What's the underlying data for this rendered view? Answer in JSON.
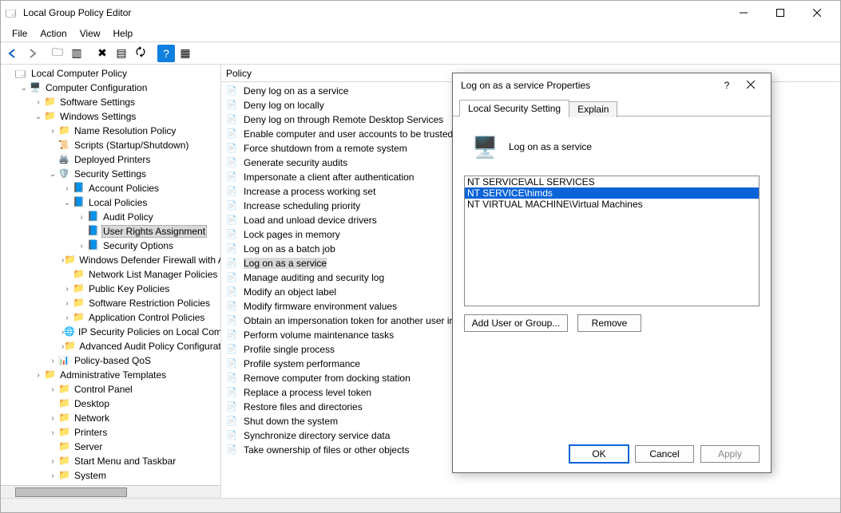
{
  "window": {
    "title": "Local Group Policy Editor"
  },
  "menu": [
    "File",
    "Action",
    "View",
    "Help"
  ],
  "tree_header": "Local Computer Policy",
  "tree": [
    {
      "ind": 0,
      "tw": "",
      "ic": "console-icon",
      "label": "Local Computer Policy"
    },
    {
      "ind": 1,
      "tw": "v",
      "ic": "pc-icon",
      "label": "Computer Configuration"
    },
    {
      "ind": 2,
      "tw": ">",
      "ic": "folder-icon",
      "label": "Software Settings"
    },
    {
      "ind": 2,
      "tw": "v",
      "ic": "folder-icon",
      "label": "Windows Settings"
    },
    {
      "ind": 3,
      "tw": ">",
      "ic": "folder-icon",
      "label": "Name Resolution Policy"
    },
    {
      "ind": 3,
      "tw": "",
      "ic": "script-icon",
      "label": "Scripts (Startup/Shutdown)"
    },
    {
      "ind": 3,
      "tw": "",
      "ic": "printer-icon",
      "label": "Deployed Printers"
    },
    {
      "ind": 3,
      "tw": "v",
      "ic": "shield-icon",
      "label": "Security Settings"
    },
    {
      "ind": 4,
      "tw": ">",
      "ic": "book-icon",
      "label": "Account Policies"
    },
    {
      "ind": 4,
      "tw": "v",
      "ic": "book-icon",
      "label": "Local Policies"
    },
    {
      "ind": 5,
      "tw": ">",
      "ic": "book-icon",
      "label": "Audit Policy"
    },
    {
      "ind": 5,
      "tw": "",
      "ic": "book-icon",
      "label": "User Rights Assignment",
      "sel": true
    },
    {
      "ind": 5,
      "tw": ">",
      "ic": "book-icon",
      "label": "Security Options"
    },
    {
      "ind": 4,
      "tw": ">",
      "ic": "folder-icon",
      "label": "Windows Defender Firewall with Advanced Security"
    },
    {
      "ind": 4,
      "tw": "",
      "ic": "folder-icon",
      "label": "Network List Manager Policies"
    },
    {
      "ind": 4,
      "tw": ">",
      "ic": "folder-icon",
      "label": "Public Key Policies"
    },
    {
      "ind": 4,
      "tw": ">",
      "ic": "folder-icon",
      "label": "Software Restriction Policies"
    },
    {
      "ind": 4,
      "tw": ">",
      "ic": "folder-icon",
      "label": "Application Control Policies"
    },
    {
      "ind": 4,
      "tw": ">",
      "ic": "globe-icon",
      "label": "IP Security Policies on Local Computer"
    },
    {
      "ind": 4,
      "tw": ">",
      "ic": "folder-icon",
      "label": "Advanced Audit Policy Configuration"
    },
    {
      "ind": 3,
      "tw": ">",
      "ic": "chart-icon",
      "label": "Policy-based QoS"
    },
    {
      "ind": 2,
      "tw": ">",
      "ic": "folder-icon",
      "label": "Administrative Templates"
    },
    {
      "ind": 3,
      "tw": ">",
      "ic": "folder-icon",
      "label": "Control Panel"
    },
    {
      "ind": 3,
      "tw": "",
      "ic": "folder-icon",
      "label": "Desktop"
    },
    {
      "ind": 3,
      "tw": ">",
      "ic": "folder-icon",
      "label": "Network"
    },
    {
      "ind": 3,
      "tw": ">",
      "ic": "folder-icon",
      "label": "Printers"
    },
    {
      "ind": 3,
      "tw": "",
      "ic": "folder-icon",
      "label": "Server"
    },
    {
      "ind": 3,
      "tw": ">",
      "ic": "folder-icon",
      "label": "Start Menu and Taskbar"
    },
    {
      "ind": 3,
      "tw": ">",
      "ic": "folder-icon",
      "label": "System"
    }
  ],
  "policy_header": "Policy",
  "policies": [
    "Deny log on as a service",
    "Deny log on locally",
    "Deny log on through Remote Desktop Services",
    "Enable computer and user accounts to be trusted for delegation",
    "Force shutdown from a remote system",
    "Generate security audits",
    "Impersonate a client after authentication",
    "Increase a process working set",
    "Increase scheduling priority",
    "Load and unload device drivers",
    "Lock pages in memory",
    "Log on as a batch job",
    "Log on as a service",
    "Manage auditing and security log",
    "Modify an object label",
    "Modify firmware environment values",
    "Obtain an impersonation token for another user in the same session",
    "Perform volume maintenance tasks",
    "Profile single process",
    "Profile system performance",
    "Remove computer from docking station",
    "Replace a process level token",
    "Restore files and directories",
    "Shut down the system",
    "Synchronize directory service data",
    "Take ownership of files or other objects"
  ],
  "selected_policy_index": 12,
  "dialog": {
    "title": "Log on as a service Properties",
    "tab1": "Local Security Setting",
    "tab2": "Explain",
    "policy_label": "Log on as a service",
    "entries": [
      "NT SERVICE\\ALL SERVICES",
      "NT SERVICE\\himds",
      "NT VIRTUAL MACHINE\\Virtual Machines"
    ],
    "selected_entry_index": 1,
    "add_btn": "Add User or Group...",
    "remove_btn": "Remove",
    "ok": "OK",
    "cancel": "Cancel",
    "apply": "Apply"
  }
}
